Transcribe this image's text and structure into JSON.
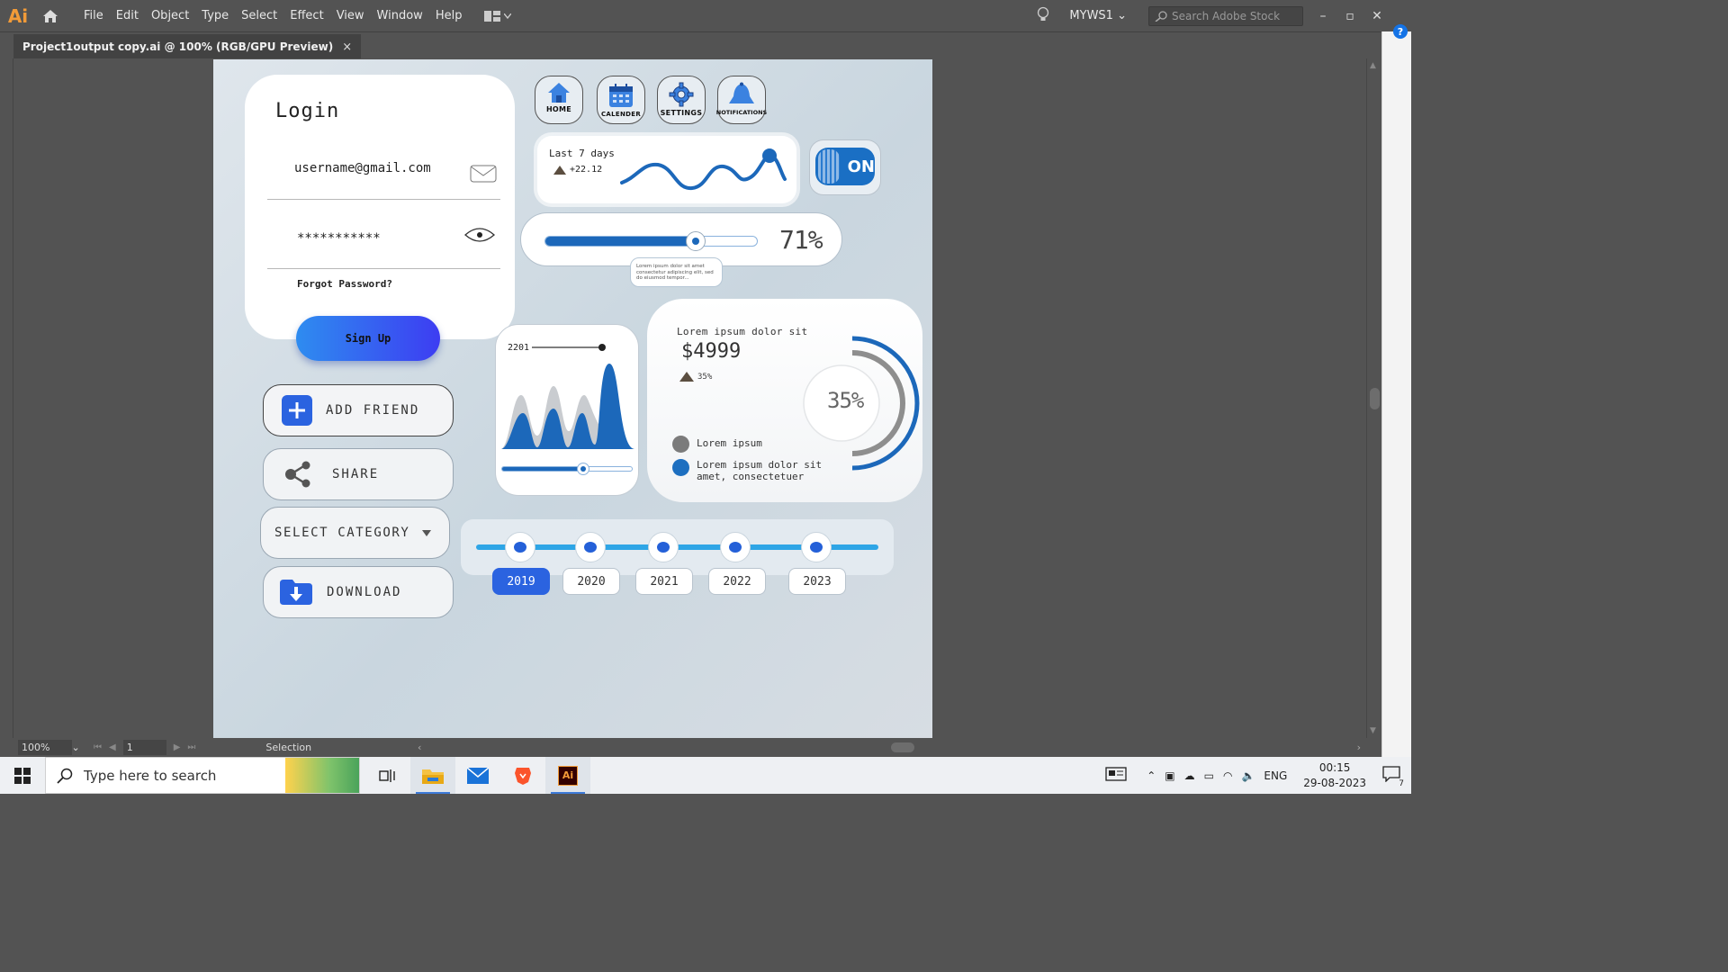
{
  "app": {
    "logo": "Ai",
    "menu": [
      "File",
      "Edit",
      "Object",
      "Type",
      "Select",
      "Effect",
      "View",
      "Window",
      "Help"
    ],
    "workspace": "MYWS1",
    "stock_placeholder": "Search Adobe Stock",
    "help": "?"
  },
  "document": {
    "tab_title": "Project1output copy.ai @ 100% (RGB/GPU Preview)",
    "close": "×"
  },
  "statusbar": {
    "zoom": "100%",
    "page": "1",
    "tool": "Selection"
  },
  "artboard": {
    "login": {
      "title": "Login",
      "email": "username@gmail.com",
      "password": "***********",
      "forgot": "Forgot Password?",
      "signup": "Sign Up"
    },
    "icon_buttons": [
      {
        "label": "HOME",
        "icon": "home-icon"
      },
      {
        "label": "CALENDER",
        "icon": "calendar-icon"
      },
      {
        "label": "SETTINGS",
        "icon": "gear-icon"
      },
      {
        "label": "NOTIFICATIONS",
        "icon": "bell-icon"
      }
    ],
    "sparkline": {
      "title": "Last 7 days",
      "delta": "+22.12"
    },
    "toggle": {
      "state": "ON"
    },
    "slider": {
      "value_label": "71%",
      "value": 0.71,
      "tooltip": "Lorem ipsum dolor sit amet consectetur adipiscing elit, sed do eiusmod tempor..."
    },
    "wave_card": {
      "label": "2201"
    },
    "stat_card": {
      "caption": "Lorem ipsum dolor sit",
      "price": "$4999",
      "change": "35%",
      "ring_label": "35%",
      "legend": [
        {
          "text": "Lorem ipsum",
          "color": "#7b7b7b"
        },
        {
          "text": "Lorem ipsum dolor sit amet, consectetuer",
          "color": "#1d6fc0"
        }
      ]
    },
    "actions": {
      "add_friend": "ADD FRIEND",
      "share": "SHARE",
      "select_category": "SELECT CATEGORY",
      "download": "DOWNLOAD"
    },
    "timeline": {
      "years": [
        "2019",
        "2020",
        "2021",
        "2022",
        "2023"
      ],
      "active": "2019"
    }
  },
  "taskbar": {
    "search_placeholder": "Type here to search",
    "language": "ENG",
    "time": "00:15",
    "date": "29-08-2023",
    "notifications": "7"
  },
  "colors": {
    "accent_blue": "#1c68ba",
    "brand_orange": "#f29b38",
    "canvas_bg": "#535353"
  }
}
